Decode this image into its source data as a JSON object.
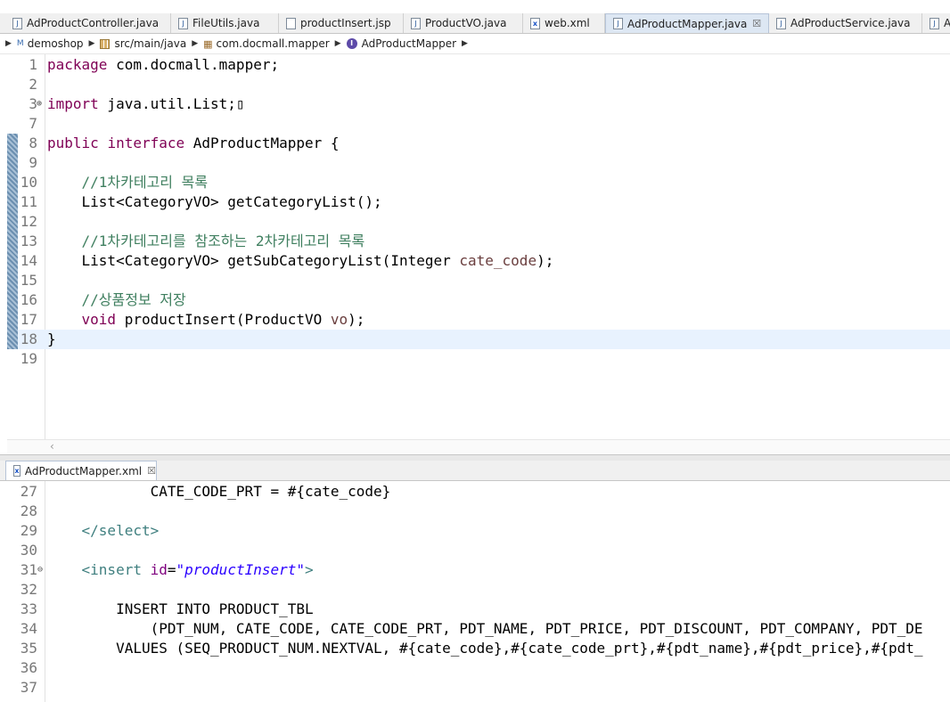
{
  "top_tabs": [
    {
      "label": "AdProductController.java",
      "icon": "java-file-icon"
    },
    {
      "label": "FileUtils.java",
      "icon": "java-file-icon"
    },
    {
      "label": "productInsert.jsp",
      "icon": "jsp-file-icon"
    },
    {
      "label": "ProductVO.java",
      "icon": "java-file-icon"
    },
    {
      "label": "web.xml",
      "icon": "xml-file-icon"
    },
    {
      "label": "AdProductMapper.java",
      "icon": "java-file-icon",
      "active": true,
      "close": "☒"
    },
    {
      "label": "AdProductService.java",
      "icon": "java-file-icon"
    },
    {
      "label": "AdP",
      "icon": "java-file-icon"
    }
  ],
  "breadcrumb": [
    "demoshop",
    "src/main/java",
    "com.docmall.mapper",
    "AdProductMapper"
  ],
  "java_editor": {
    "lines": [
      {
        "n": "1",
        "parts": [
          {
            "t": "package",
            "c": "kw"
          },
          {
            "t": " com.docmall.mapper;",
            "c": ""
          }
        ]
      },
      {
        "n": "2",
        "parts": []
      },
      {
        "n": "3",
        "fold": "⊕",
        "parts": [
          {
            "t": "import",
            "c": "kw"
          },
          {
            "t": " java.util.List;▯",
            "c": ""
          }
        ]
      },
      {
        "n": "7",
        "parts": []
      },
      {
        "n": "8",
        "parts": [
          {
            "t": "public",
            "c": "kw"
          },
          {
            "t": " ",
            "c": ""
          },
          {
            "t": "interface",
            "c": "kw"
          },
          {
            "t": " AdProductMapper {",
            "c": ""
          }
        ]
      },
      {
        "n": "9",
        "parts": []
      },
      {
        "n": "10",
        "parts": [
          {
            "t": "    //1차카테고리 목록",
            "c": "cm"
          }
        ]
      },
      {
        "n": "11",
        "parts": [
          {
            "t": "    List<CategoryVO> getCategoryList();",
            "c": ""
          }
        ]
      },
      {
        "n": "12",
        "parts": []
      },
      {
        "n": "13",
        "parts": [
          {
            "t": "    //1차카테고리를 참조하는 2차카테고리 목록",
            "c": "cm"
          }
        ]
      },
      {
        "n": "14",
        "parts": [
          {
            "t": "    List<CategoryVO> getSubCategoryList(Integer ",
            "c": ""
          },
          {
            "t": "cate_code",
            "c": "vr"
          },
          {
            "t": ");",
            "c": ""
          }
        ]
      },
      {
        "n": "15",
        "parts": []
      },
      {
        "n": "16",
        "parts": [
          {
            "t": "    //상품정보 저장",
            "c": "cm"
          }
        ]
      },
      {
        "n": "17",
        "parts": [
          {
            "t": "    ",
            "c": ""
          },
          {
            "t": "void",
            "c": "kw"
          },
          {
            "t": " productInsert(ProductVO ",
            "c": ""
          },
          {
            "t": "vo",
            "c": "vr"
          },
          {
            "t": ");",
            "c": ""
          }
        ]
      },
      {
        "n": "18",
        "current": true,
        "parts": [
          {
            "t": "}",
            "c": ""
          }
        ]
      },
      {
        "n": "19",
        "parts": []
      }
    ]
  },
  "bottom_tab": {
    "label": "AdProductMapper.xml",
    "close": "☒"
  },
  "xml_editor": {
    "lines": [
      {
        "n": "27",
        "parts": [
          {
            "t": "            CATE_CODE_PRT = #{cate_code}",
            "c": ""
          }
        ]
      },
      {
        "n": "28",
        "parts": []
      },
      {
        "n": "29",
        "parts": [
          {
            "t": "    ",
            "c": ""
          },
          {
            "t": "</select>",
            "c": "tg"
          }
        ]
      },
      {
        "n": "30",
        "parts": []
      },
      {
        "n": "31",
        "fold": "⊖",
        "parts": [
          {
            "t": "    ",
            "c": ""
          },
          {
            "t": "<insert",
            "c": "tg"
          },
          {
            "t": " ",
            "c": ""
          },
          {
            "t": "id",
            "c": "at"
          },
          {
            "t": "=",
            "c": ""
          },
          {
            "t": "\"productInsert\"",
            "c": "av"
          },
          {
            "t": ">",
            "c": "tg"
          }
        ]
      },
      {
        "n": "32",
        "parts": []
      },
      {
        "n": "33",
        "parts": [
          {
            "t": "        INSERT INTO PRODUCT_TBL",
            "c": ""
          }
        ]
      },
      {
        "n": "34",
        "parts": [
          {
            "t": "            (PDT_NUM, CATE_CODE, CATE_CODE_PRT, PDT_NAME, PDT_PRICE, PDT_DISCOUNT, PDT_COMPANY, PDT_DE",
            "c": ""
          }
        ]
      },
      {
        "n": "35",
        "parts": [
          {
            "t": "        VALUES (SEQ_PRODUCT_NUM.NEXTVAL, #{cate_code},#{cate_code_prt},#{pdt_name},#{pdt_price},#{pdt_",
            "c": ""
          }
        ]
      },
      {
        "n": "36",
        "parts": []
      },
      {
        "n": "37",
        "parts": []
      }
    ]
  }
}
